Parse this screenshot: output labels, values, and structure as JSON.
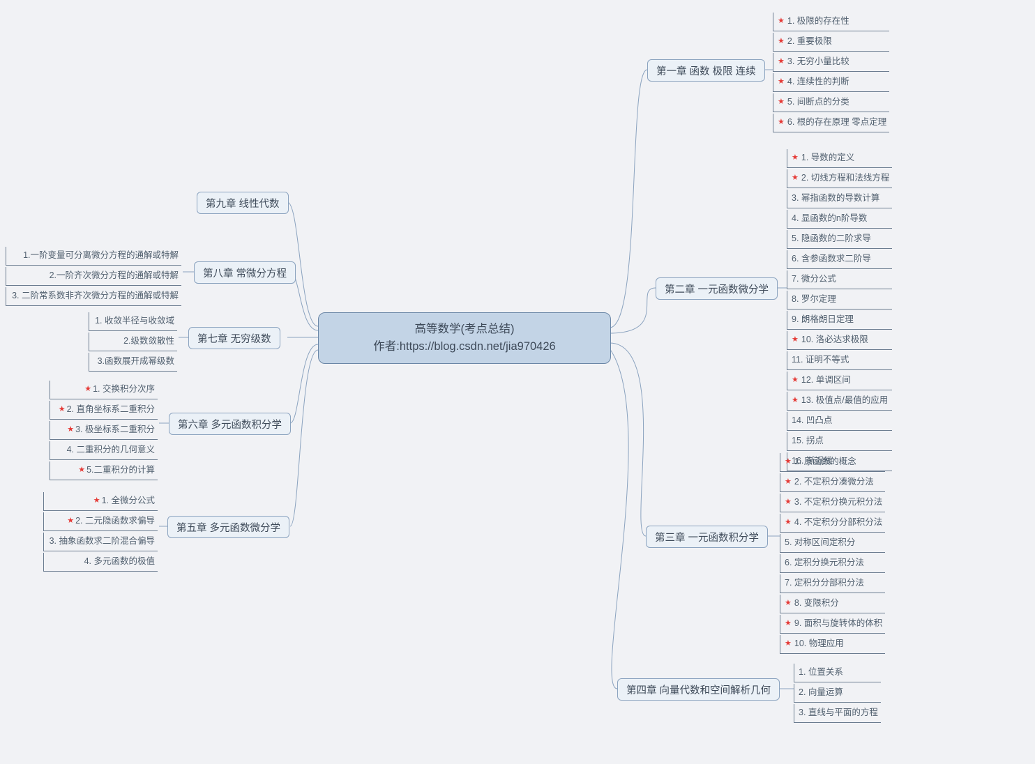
{
  "center": {
    "line1": "高等数学(考点总结)",
    "line2": "作者:https://blog.csdn.net/jia970426"
  },
  "right": {
    "ch1": {
      "title": "第一章 函数 极限 连续",
      "items": [
        {
          "star": true,
          "t": "1. 极限的存在性"
        },
        {
          "star": true,
          "t": "2. 重要极限"
        },
        {
          "star": true,
          "t": "3. 无穷小量比较"
        },
        {
          "star": true,
          "t": "4. 连续性的判断"
        },
        {
          "star": true,
          "t": "5. 间断点的分类"
        },
        {
          "star": true,
          "t": "6. 根的存在原理 零点定理"
        }
      ]
    },
    "ch2": {
      "title": "第二章  一元函数微分学",
      "items": [
        {
          "star": true,
          "t": "1. 导数的定义"
        },
        {
          "star": true,
          "t": "2. 切线方程和法线方程"
        },
        {
          "star": false,
          "t": "3. 幂指函数的导数计算"
        },
        {
          "star": false,
          "t": "4. 显函数的n阶导数"
        },
        {
          "star": false,
          "t": "5. 隐函数的二阶求导"
        },
        {
          "star": false,
          "t": "6. 含参函数求二阶导"
        },
        {
          "star": false,
          "t": "7. 微分公式"
        },
        {
          "star": false,
          "t": "8. 罗尔定理"
        },
        {
          "star": false,
          "t": "9. 朗格朗日定理"
        },
        {
          "star": true,
          "t": "10. 洛必达求极限"
        },
        {
          "star": false,
          "t": "11. 证明不等式"
        },
        {
          "star": true,
          "t": "12. 单调区间"
        },
        {
          "star": true,
          "t": "13. 极值点/最值的应用"
        },
        {
          "star": false,
          "t": "14. 凹凸点"
        },
        {
          "star": false,
          "t": "15. 拐点"
        },
        {
          "star": false,
          "t": "16. 渐近线"
        }
      ]
    },
    "ch3": {
      "title": "第三章 一元函数积分学",
      "items": [
        {
          "star": true,
          "t": "1. 原函数的概念"
        },
        {
          "star": true,
          "t": "2. 不定积分凑微分法"
        },
        {
          "star": true,
          "t": "3. 不定积分换元积分法"
        },
        {
          "star": true,
          "t": "4. 不定积分分部积分法"
        },
        {
          "star": false,
          "t": "5. 对称区间定积分"
        },
        {
          "star": false,
          "t": "6. 定积分换元积分法"
        },
        {
          "star": false,
          "t": "7. 定积分分部积分法"
        },
        {
          "star": true,
          "t": "8. 变限积分"
        },
        {
          "star": true,
          "t": "9. 面积与旋转体的体积"
        },
        {
          "star": true,
          "t": "10. 物理应用"
        }
      ]
    },
    "ch4": {
      "title": "第四章 向量代数和空间解析几何",
      "items": [
        {
          "star": false,
          "t": "1. 位置关系"
        },
        {
          "star": false,
          "t": "2. 向量运算"
        },
        {
          "star": false,
          "t": "3. 直线与平面的方程"
        }
      ]
    }
  },
  "left": {
    "ch9": {
      "title": "第九章 线性代数",
      "items": []
    },
    "ch8": {
      "title": "第八章 常微分方程",
      "items": [
        {
          "star": false,
          "t": "1.一阶变量可分离微分方程的通解或特解"
        },
        {
          "star": false,
          "t": "2.一阶齐次微分方程的通解或特解"
        },
        {
          "star": false,
          "t": "3. 二阶常系数非齐次微分方程的通解或特解"
        }
      ]
    },
    "ch7": {
      "title": "第七章 无穷级数",
      "items": [
        {
          "star": false,
          "t": "1. 收敛半径与收敛域"
        },
        {
          "star": false,
          "t": "2.级数敛散性"
        },
        {
          "star": false,
          "t": "3.函数展开成幂级数"
        }
      ]
    },
    "ch6": {
      "title": "第六章 多元函数积分学",
      "items": [
        {
          "star": true,
          "t": "1. 交换积分次序"
        },
        {
          "star": true,
          "t": "2. 直角坐标系二重积分"
        },
        {
          "star": true,
          "t": "3. 极坐标系二重积分"
        },
        {
          "star": false,
          "t": "4. 二重积分的几何意义"
        },
        {
          "star": true,
          "t": "5.二重积分的计算"
        }
      ]
    },
    "ch5": {
      "title": "第五章 多元函数微分学",
      "items": [
        {
          "star": true,
          "t": "1. 全微分公式"
        },
        {
          "star": true,
          "t": "2. 二元隐函数求偏导"
        },
        {
          "star": false,
          "t": "3. 抽象函数求二阶混合偏导"
        },
        {
          "star": false,
          "t": "4. 多元函数的极值"
        }
      ]
    }
  }
}
